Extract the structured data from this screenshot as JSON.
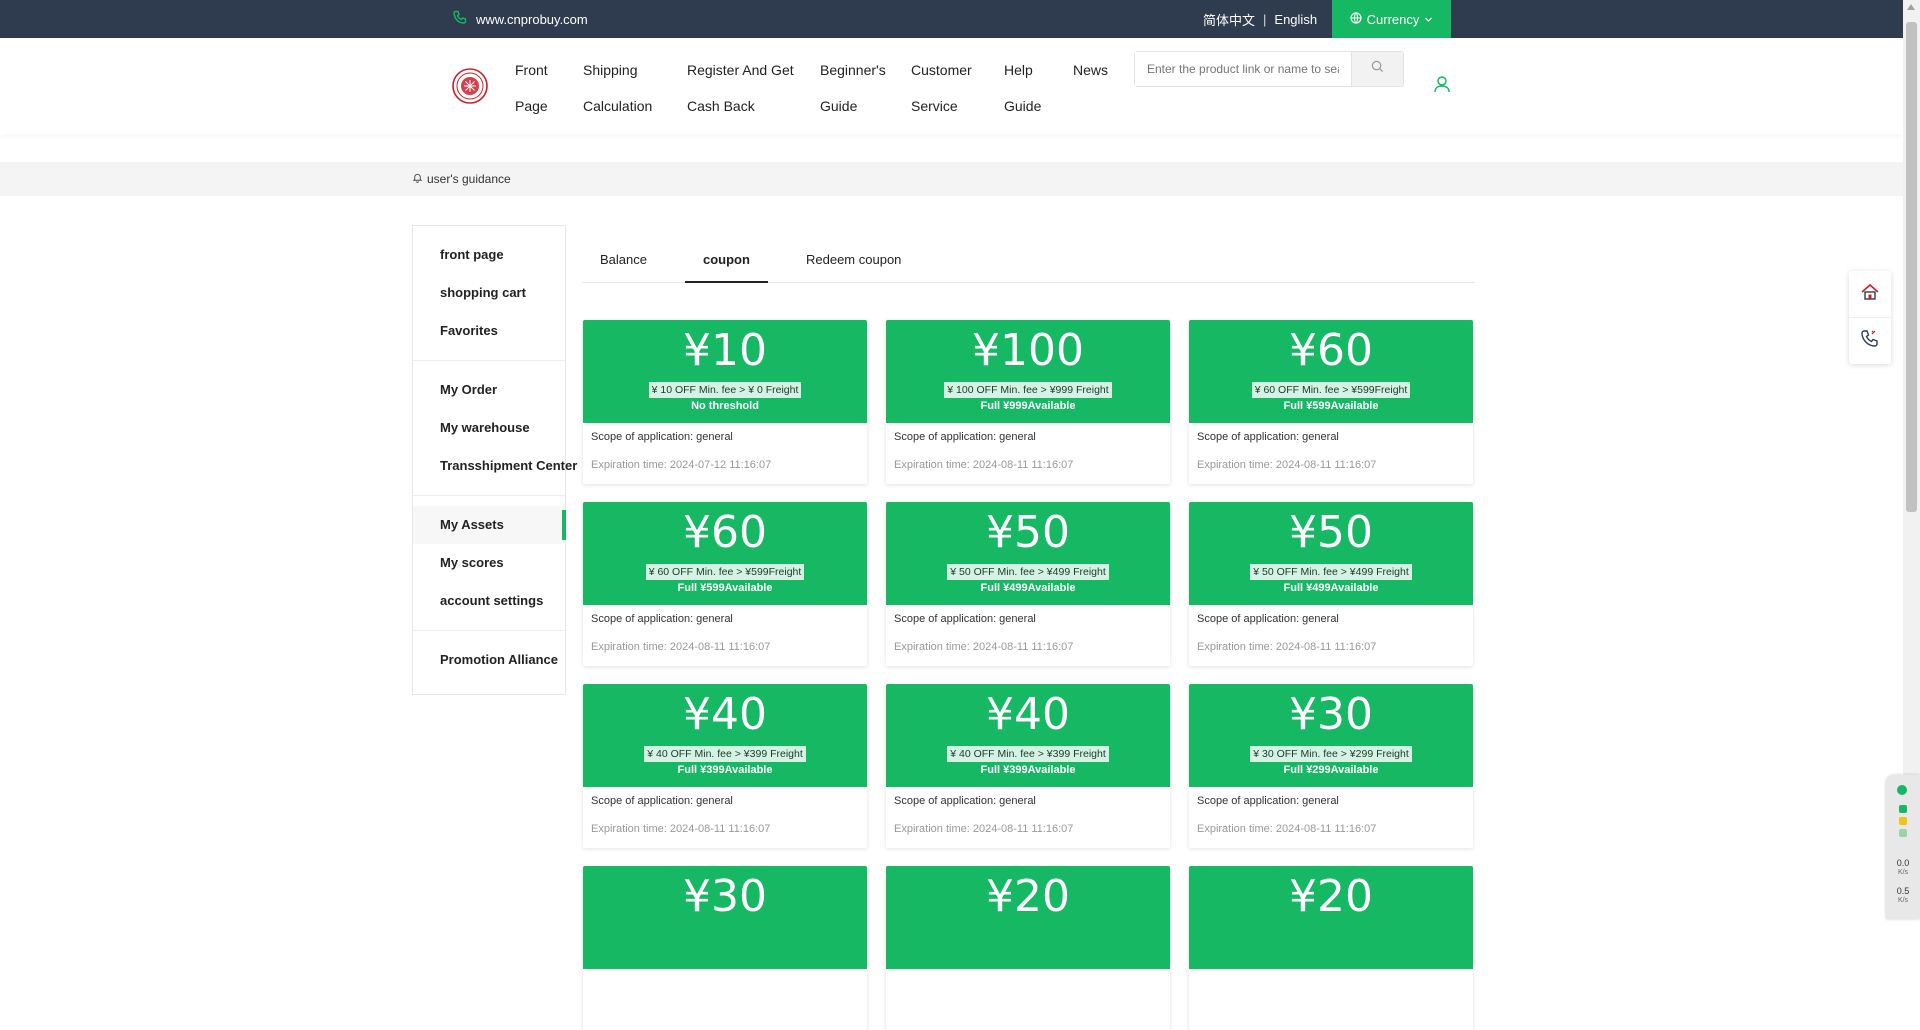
{
  "topbar": {
    "site": "www.cnprobuy.com",
    "lang_cn": "简体中文",
    "lang_sep": "|",
    "lang_en": "English",
    "currency": "Currency"
  },
  "nav": [
    {
      "l1": "Front",
      "l2": "Page"
    },
    {
      "l1": "Shipping",
      "l2": "Calculation"
    },
    {
      "l1": "Register And Get",
      "l2": "Cash Back"
    },
    {
      "l1": "Beginner's",
      "l2": "Guide"
    },
    {
      "l1": "Customer",
      "l2": "Service"
    },
    {
      "l1": "Help",
      "l2": "Guide"
    },
    {
      "l1": "News",
      "l2": ""
    }
  ],
  "search": {
    "placeholder": "Enter the product link or name to search"
  },
  "notice": {
    "text": "user's guidance"
  },
  "sidebar": {
    "group1": [
      "front page",
      "shopping cart",
      "Favorites"
    ],
    "group2": [
      "My Order",
      "My warehouse",
      "Transshipment Center"
    ],
    "group3": [
      "My Assets",
      "My scores",
      "account settings"
    ],
    "group4": [
      "Promotion Alliance"
    ]
  },
  "tabs": [
    "Balance",
    "coupon",
    "Redeem coupon"
  ],
  "coupons": [
    {
      "amount": "¥10",
      "rule": "¥ 10 OFF Min. fee > ¥ 0 Freight",
      "cond": "No threshold",
      "scope": "Scope of application: general",
      "exp": "Expiration time: 2024-07-12 11:16:07"
    },
    {
      "amount": "¥100",
      "rule": "¥ 100 OFF Min. fee > ¥999 Freight",
      "cond": "Full ¥999Available",
      "scope": "Scope of application: general",
      "exp": "Expiration time: 2024-08-11 11:16:07"
    },
    {
      "amount": "¥60",
      "rule": "¥ 60 OFF Min. fee > ¥599Freight",
      "cond": "Full ¥599Available",
      "scope": "Scope of application: general",
      "exp": "Expiration time: 2024-08-11 11:16:07"
    },
    {
      "amount": "¥60",
      "rule": "¥ 60 OFF Min. fee > ¥599Freight",
      "cond": "Full ¥599Available",
      "scope": "Scope of application: general",
      "exp": "Expiration time: 2024-08-11 11:16:07"
    },
    {
      "amount": "¥50",
      "rule": "¥ 50 OFF Min. fee > ¥499 Freight",
      "cond": "Full ¥499Available",
      "scope": "Scope of application: general",
      "exp": "Expiration time: 2024-08-11 11:16:07"
    },
    {
      "amount": "¥50",
      "rule": "¥ 50 OFF Min. fee > ¥499 Freight",
      "cond": "Full ¥499Available",
      "scope": "Scope of application: general",
      "exp": "Expiration time: 2024-08-11 11:16:07"
    },
    {
      "amount": "¥40",
      "rule": "¥ 40 OFF Min. fee > ¥399 Freight",
      "cond": "Full ¥399Available",
      "scope": "Scope of application: general",
      "exp": "Expiration time: 2024-08-11 11:16:07"
    },
    {
      "amount": "¥40",
      "rule": "¥ 40 OFF Min. fee > ¥399 Freight",
      "cond": "Full ¥399Available",
      "scope": "Scope of application: general",
      "exp": "Expiration time: 2024-08-11 11:16:07"
    },
    {
      "amount": "¥30",
      "rule": "¥ 30 OFF Min. fee > ¥299 Freight",
      "cond": "Full ¥299Available",
      "scope": "Scope of application: general",
      "exp": "Expiration time: 2024-08-11 11:16:07"
    },
    {
      "amount": "¥30",
      "rule": "",
      "cond": "",
      "scope": "",
      "exp": ""
    },
    {
      "amount": "¥20",
      "rule": "",
      "cond": "",
      "scope": "",
      "exp": ""
    },
    {
      "amount": "¥20",
      "rule": "",
      "cond": "",
      "scope": "",
      "exp": ""
    }
  ],
  "speed": {
    "down": "0.0",
    "down_unit": "K/s",
    "up": "0.5",
    "up_unit": "K/s"
  },
  "colors": {
    "accent": "#16b864",
    "topbar": "#2f3b4e"
  },
  "icons": [
    "phone-icon",
    "globe-icon",
    "chevron-down-icon",
    "logo",
    "search-icon",
    "user-icon",
    "bell-icon",
    "home-icon",
    "telephone-icon"
  ]
}
